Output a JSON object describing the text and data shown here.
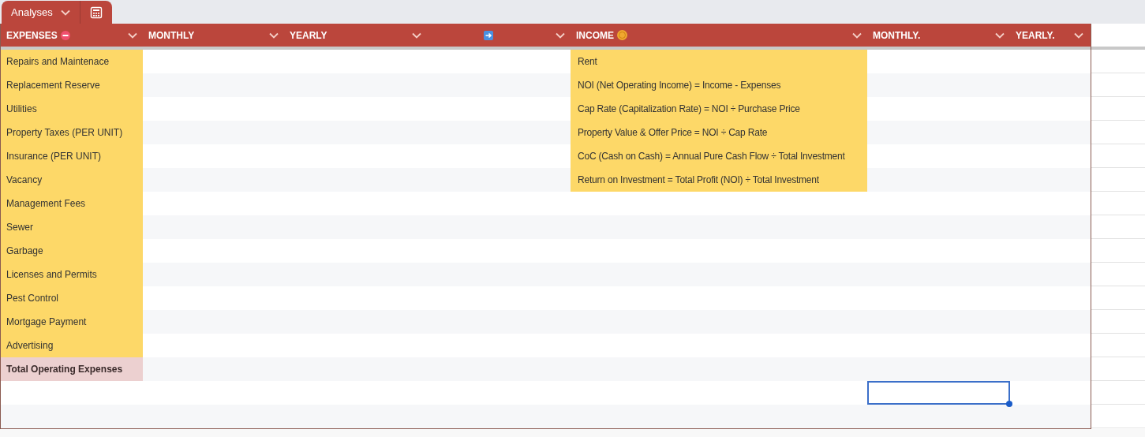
{
  "sheet_tab": {
    "label": "Analyses",
    "selected": true
  },
  "columns": [
    {
      "label": "EXPENSES"
    },
    {
      "label": "MONTHLY"
    },
    {
      "label": "YEARLY"
    },
    {},
    {
      "label": "INCOME"
    },
    {
      "label": "MONTHLY."
    },
    {
      "label": "YEARLY."
    }
  ],
  "rows": [
    {
      "expense": "Repairs and Maintenace",
      "kind": "item",
      "income": "Rent",
      "selected": false
    },
    {
      "expense": "Replacement Reserve",
      "kind": "item",
      "income": "NOI (Net Operating Income) = Income - Expenses",
      "selected": false
    },
    {
      "expense": "Utilities",
      "kind": "item",
      "income": "Cap Rate (Capitalization Rate) = NOI ÷  Purchase Price",
      "selected": false
    },
    {
      "expense": "Property Taxes (PER UNIT)",
      "kind": "item",
      "income": "Property Value & Offer Price = NOI ÷ Cap Rate",
      "selected": false
    },
    {
      "expense": "Insurance (PER UNIT)",
      "kind": "item",
      "income": "CoC (Cash on Cash) = Annual Pure Cash Flow ÷ Total Investment",
      "selected": false
    },
    {
      "expense": "Vacancy",
      "kind": "item",
      "income": "Return on Investment = Total Profit (NOI) ÷ Total Investment",
      "selected": false
    },
    {
      "expense": "Management Fees",
      "kind": "item",
      "selected": false
    },
    {
      "expense": "Sewer",
      "kind": "item",
      "selected": false
    },
    {
      "expense": "Garbage",
      "kind": "item",
      "selected": false
    },
    {
      "expense": "Licenses and Permits",
      "kind": "item",
      "selected": false
    },
    {
      "expense": "Pest Control",
      "kind": "item",
      "selected": false
    },
    {
      "expense": "Mortgage Payment",
      "kind": "item",
      "selected": false
    },
    {
      "expense": "Advertising",
      "kind": "item",
      "selected": false
    },
    {
      "expense": "Total Operating Expenses",
      "kind": "total",
      "selected": false
    },
    {
      "selected": true
    },
    {
      "selected": false
    }
  ]
}
